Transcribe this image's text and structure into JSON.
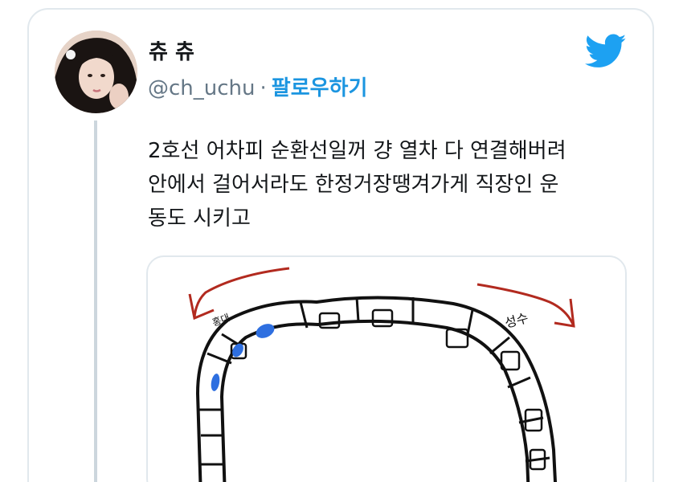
{
  "tweet": {
    "display_name": "츄 츄",
    "handle": "@ch_uchu",
    "separator": "·",
    "follow_label": "팔로우하기",
    "text_lines": [
      "2호선 어차피 순환선일꺼 걍 열차 다 연결해버려",
      "안에서 걸어서라도 한정거장땡겨가게 직장인 운",
      "동도 시키고"
    ]
  },
  "drawing": {
    "label_left": "홍대",
    "label_right": "성수"
  },
  "icons": {
    "brand": "twitter-bird-icon"
  },
  "colors": {
    "twitter_blue": "#1da1f2",
    "follow_blue": "#1b95e0",
    "arrow_red": "#b22a1f",
    "passenger_blue": "#2e6fe0"
  }
}
